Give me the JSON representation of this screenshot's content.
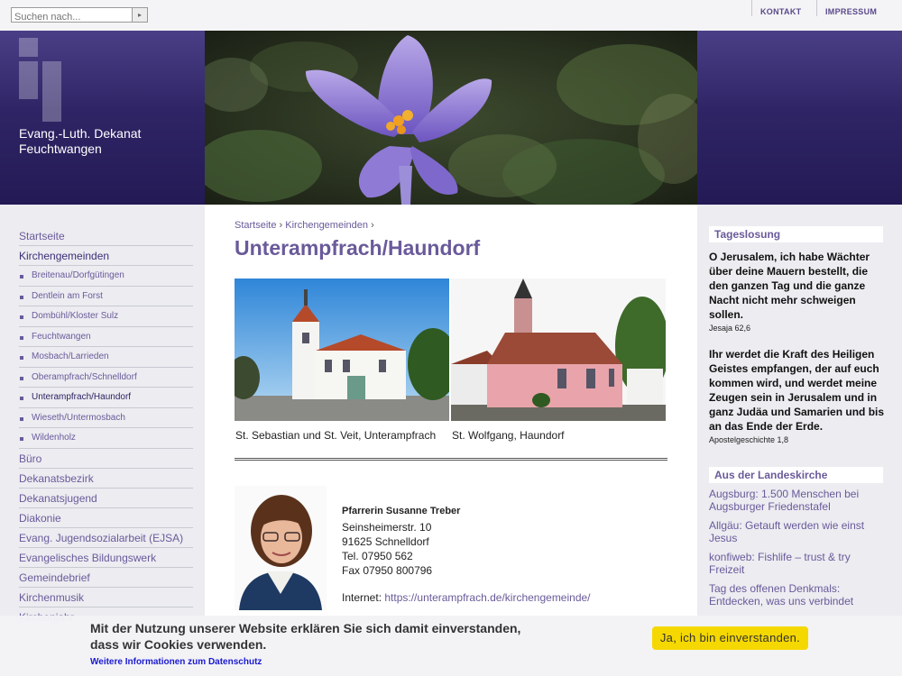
{
  "search": {
    "placeholder": "Suchen nach...",
    "button": "▸"
  },
  "toplinks": [
    "KONTAKT",
    "IMPRESSUM"
  ],
  "brand": {
    "line1": "Evang.-Luth. Dekanat",
    "line2": "Feuchtwangen"
  },
  "nav": {
    "items": [
      "Startseite",
      "Kirchengemeinden"
    ],
    "subitems": [
      "Breitenau/Dorfgütingen",
      "Dentlein am Forst",
      "Dombühl/Kloster Sulz",
      "Feuchtwangen",
      "Mosbach/Larrieden",
      "Oberampfrach/Schnelldorf",
      "Unterampfrach/Haundorf",
      "Wieseth/Untermosbach",
      "Wildenholz"
    ],
    "more": [
      "Büro",
      "Dekanatsbezirk",
      "Dekanatsjugend",
      "Diakonie",
      "Evang. Jugendsozialarbeit (EJSA)",
      "Evangelisches Bildungswerk",
      "Gemeindebrief",
      "Kirchenmusik",
      "Kirchenjahr"
    ]
  },
  "breadcrumb": {
    "home": "Startseite",
    "parent": "Kirchengemeinden",
    "sep": "›"
  },
  "page_title": "Unterampfrach/Haundorf",
  "captions": [
    "St. Sebastian und St. Veit, Unterampfrach",
    "St. Wolfgang, Haundorf"
  ],
  "contact": {
    "name": "Pfarrerin Susanne Treber",
    "street": "Seinsheimerstr. 10",
    "city": "91625 Schnelldorf",
    "tel": "Tel. 07950 562",
    "fax": "Fax 07950 800796",
    "internet_label": "Internet:",
    "url": "https://unterampfrach.de/kirchengemeinde/"
  },
  "losung": {
    "title": "Tageslosung",
    "verse1": "O Jerusalem, ich habe Wächter über deine Mauern bestellt, die den ganzen Tag und die ganze Nacht nicht mehr schweigen sollen.",
    "ref1": "Jesaja 62,6",
    "verse2": "Ihr werdet die Kraft des Heiligen Geistes empfangen, der auf euch kommen wird, und werdet meine Zeugen sein in Jerusalem und in ganz Judäa und Samarien und bis an das Ende der Erde.",
    "ref2": "Apostelgeschichte 1,8"
  },
  "landeskirche": {
    "title": "Aus der Landeskirche",
    "items": [
      "Augsburg: 1.500 Menschen bei Augsburger Friedenstafel",
      "Allgäu: Getauft werden wie einst Jesus",
      "konfiweb: Fishlife – trust & try Freizeit",
      "Tag des offenen Denkmals: Entdecken, was uns verbindet"
    ]
  },
  "cookie": {
    "line1": "Mit der Nutzung unserer Website erklären Sie sich damit einverstanden,",
    "line2": "dass wir Cookies verwenden.",
    "link": "Weitere Informationen zum Datenschutz",
    "accept": "Ja, ich bin einverstanden."
  }
}
